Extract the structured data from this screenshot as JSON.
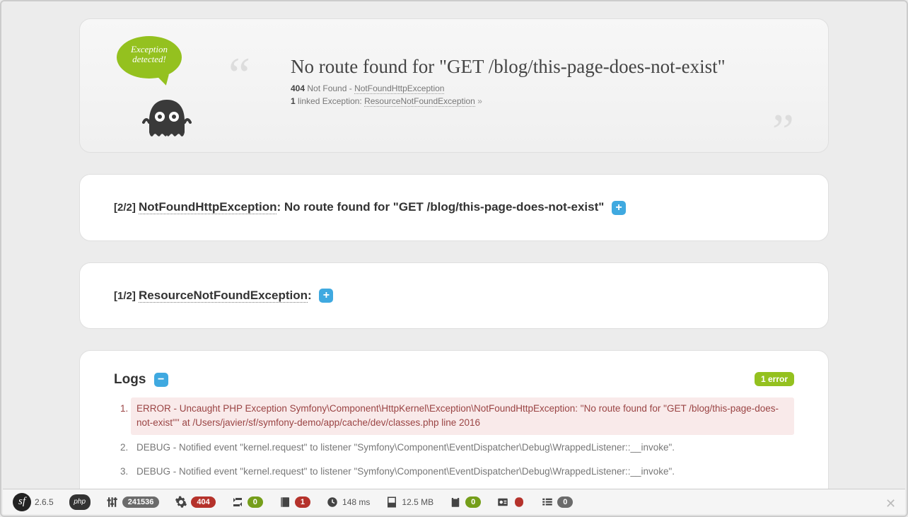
{
  "header": {
    "bubble_line1": "Exception",
    "bubble_line2": "detected!",
    "title": "No route found for \"GET /blog/this-page-does-not-exist\"",
    "status_code": "404",
    "status_text": "Not Found - ",
    "status_exception": "NotFoundHttpException",
    "linked_count": "1",
    "linked_label": " linked Exception: ",
    "linked_exception": "ResourceNotFoundException",
    "linked_arrow": " »"
  },
  "exceptions": [
    {
      "index": "[2/2] ",
      "name": "NotFoundHttpException",
      "message": ": No route found for \"GET /blog/this-page-does-not-exist\"  "
    },
    {
      "index": "[1/2] ",
      "name": "ResourceNotFoundException",
      "message": ":  "
    }
  ],
  "logs": {
    "title": "Logs ",
    "error_badge": "1 error",
    "items": [
      {
        "level": "error",
        "text": "ERROR - Uncaught PHP Exception Symfony\\Component\\HttpKernel\\Exception\\NotFoundHttpException: \"No route found for \"GET /blog/this-page-does-not-exist\"\" at /Users/javier/sf/symfony-demo/app/cache/dev/classes.php line 2016"
      },
      {
        "level": "debug",
        "text": "DEBUG - Notified event \"kernel.request\" to listener \"Symfony\\Component\\EventDispatcher\\Debug\\WrappedListener::__invoke\"."
      },
      {
        "level": "debug",
        "text": "DEBUG - Notified event \"kernel.request\" to listener \"Symfony\\Component\\EventDispatcher\\Debug\\WrappedListener::__invoke\"."
      }
    ]
  },
  "toolbar": {
    "version": "2.6.5",
    "token": "241536",
    "status": "404",
    "ajax": "0",
    "db": "1",
    "time": "148 ms",
    "memory": "12.5 MB",
    "forms": "0",
    "list": "0"
  },
  "toggle_plus": "+",
  "toggle_minus": "−"
}
